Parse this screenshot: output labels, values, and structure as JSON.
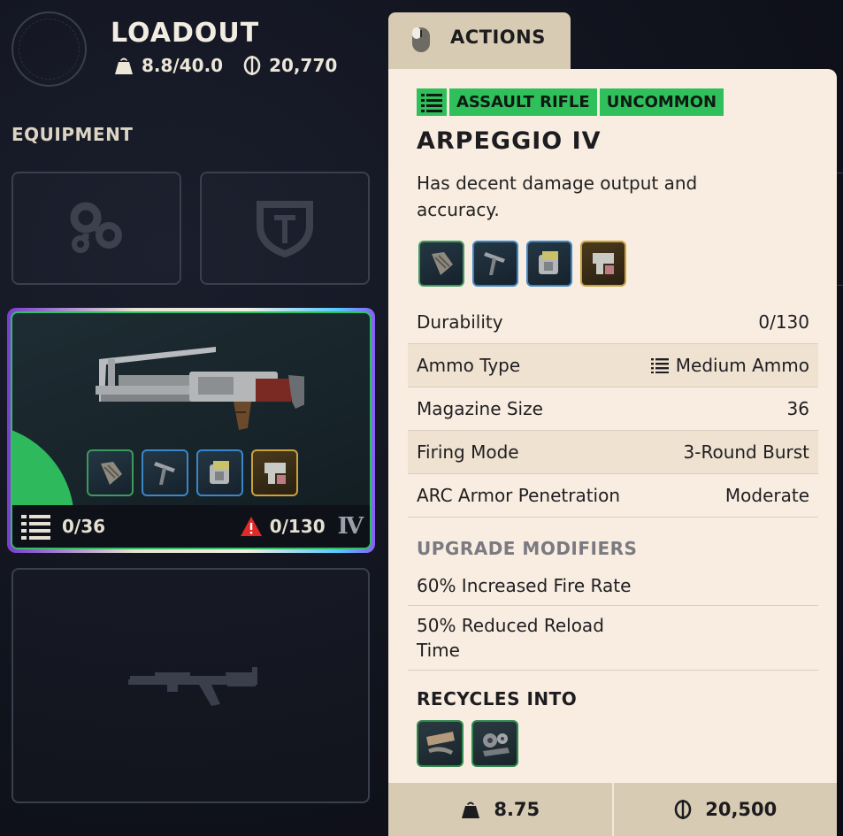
{
  "loadout": {
    "title": "LOADOUT",
    "weight": "8.8/40.0",
    "currency": "20,770"
  },
  "equipment": {
    "label": "EQUIPMENT",
    "slots": [
      {
        "icon": "augment-icon"
      },
      {
        "icon": "shield-icon"
      }
    ]
  },
  "weapon_card": {
    "ammo": "0/36",
    "durability": "0/130",
    "tier": "IV",
    "attachments": [
      {
        "icon": "muzzle-icon",
        "rarity_color": "#3d9a5c"
      },
      {
        "icon": "underbarrel-icon",
        "rarity_color": "#3b86c7"
      },
      {
        "icon": "magazine-icon",
        "rarity_color": "#3b86c7"
      },
      {
        "icon": "stock-icon",
        "rarity_color": "#c9a23a"
      }
    ]
  },
  "actions_tab": {
    "label": "ACTIONS"
  },
  "tooltip": {
    "tags": [
      "ASSAULT RIFLE",
      "UNCOMMON"
    ],
    "name": "ARPEGGIO IV",
    "description": "Has decent damage output and accuracy.",
    "stats": [
      {
        "label": "Durability",
        "value": "0/130"
      },
      {
        "label": "Ammo Type",
        "value": "Medium Ammo"
      },
      {
        "label": "Magazine Size",
        "value": "36"
      },
      {
        "label": "Firing Mode",
        "value": "3-Round Burst"
      },
      {
        "label": "ARC Armor Penetration",
        "value": "Moderate"
      }
    ],
    "upgrade_heading": "UPGRADE MODIFIERS",
    "modifiers": [
      "60% Increased Fire Rate",
      "50% Reduced Reload Time"
    ],
    "recycle_heading": "RECYCLES INTO",
    "footer": {
      "weight": "8.75",
      "value": "20,500"
    }
  },
  "colors": {
    "rarity_uncommon": "#2fc05c",
    "panel_bg": "#f8ede0",
    "tab_bg": "#d8cbb4",
    "warning": "#e02a2a"
  }
}
